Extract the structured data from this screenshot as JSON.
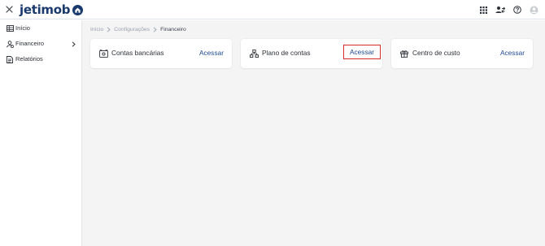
{
  "header": {
    "logo_text": "jetimob",
    "close_icon": "close-icon",
    "icons": [
      "apps-grid-icon",
      "switch-account-icon",
      "help-icon",
      "user-avatar-icon"
    ]
  },
  "sidebar": {
    "items": [
      {
        "label": "Início",
        "icon": "table-icon"
      },
      {
        "label": "Financeiro",
        "icon": "user-finance-icon",
        "has_submenu": true
      },
      {
        "label": "Relatórios",
        "icon": "document-icon"
      }
    ]
  },
  "breadcrumb": {
    "items": [
      "Início",
      "Configurações"
    ],
    "current": "Financeiro"
  },
  "cards": [
    {
      "title": "Contas bancárias",
      "action": "Acessar",
      "icon": "bank-account-icon",
      "highlighted": false
    },
    {
      "title": "Plano de contas",
      "action": "Acessar",
      "icon": "hierarchy-icon",
      "highlighted": true
    },
    {
      "title": "Centro de custo",
      "action": "Acessar",
      "icon": "gift-box-icon",
      "highlighted": false
    }
  ],
  "colors": {
    "brand": "#1a3a6e",
    "link": "#1f4a92",
    "highlight": "#d32f2f",
    "background": "#f4f4f5"
  }
}
